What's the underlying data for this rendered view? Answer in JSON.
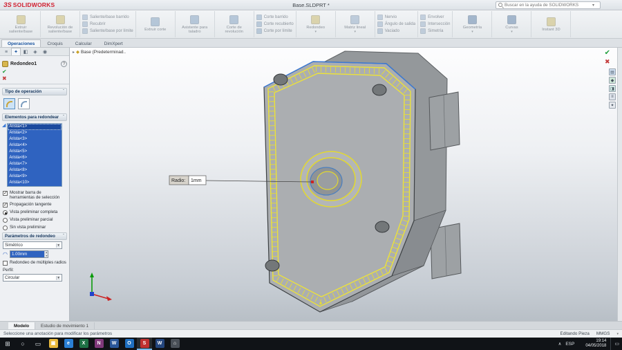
{
  "colors": {
    "selection_blue": "#2f63c0",
    "highlight_yellow": "#e8de30",
    "edge_blue": "#3b7ad6",
    "accept_green": "#1f9e3c",
    "cancel_red": "#c43b3b"
  },
  "title_bar": {
    "logo_glyph": "ЗS",
    "logo_text": "SOLIDWORKS",
    "quick_tools": [
      {
        "name": "new-document-icon",
        "glyph": "▢"
      },
      {
        "name": "open-document-icon",
        "glyph": "◫"
      },
      {
        "name": "save-icon",
        "glyph": "▦"
      },
      {
        "name": "print-icon",
        "glyph": "▤"
      },
      {
        "name": "undo-icon",
        "glyph": "↶"
      },
      {
        "name": "redo-icon",
        "glyph": "↷"
      },
      {
        "name": "options-caret-icon",
        "glyph": "▾"
      }
    ],
    "document_title": "Base.SLDPRT *",
    "search_placeholder": "Buscar en la ayuda de SOLIDWORKS",
    "search_caret": "▾",
    "window_controls": [
      {
        "name": "help-button",
        "glyph": "?"
      },
      {
        "name": "minimize-button",
        "glyph": "–"
      },
      {
        "name": "maximize-button",
        "glyph": "▢"
      },
      {
        "name": "close-button",
        "glyph": "✕"
      }
    ]
  },
  "ribbon": {
    "groups": [
      {
        "kind": "big",
        "name": "ribbon-extrude-boss",
        "label": "Extruir saliente/base",
        "color": "#c9b86a"
      },
      {
        "kind": "big",
        "name": "ribbon-revolve-boss",
        "label": "Revolución de saliente/base",
        "color": "#c9b86a"
      },
      {
        "kind": "stack",
        "name": "ribbon-boss-stack",
        "labels": [
          "Saliente/base barrido",
          "Recubrir",
          "Saliente/base por límite"
        ],
        "color": "#8fa8c4"
      },
      {
        "kind": "big",
        "name": "ribbon-extrude-cut",
        "label": "Extruir corte",
        "color": "#7f9fc0"
      },
      {
        "kind": "big",
        "name": "ribbon-hole-wizard",
        "label": "Asistente para taladro",
        "color": "#7f9fc0"
      },
      {
        "kind": "big",
        "name": "ribbon-revolve-cut",
        "label": "Corte de revolución",
        "color": "#7f9fc0"
      },
      {
        "kind": "stack",
        "name": "ribbon-cut-stack",
        "labels": [
          "Corte barrido",
          "Corte recubierto",
          "Corte por límite"
        ],
        "color": "#7f9fc0"
      },
      {
        "kind": "big",
        "name": "ribbon-fillet",
        "label": "Redondeo",
        "arrow": true,
        "color": "#c9b86a"
      },
      {
        "kind": "big",
        "name": "ribbon-linear-pattern",
        "label": "Matriz lineal",
        "arrow": true,
        "color": "#8fa8c4"
      },
      {
        "kind": "stack",
        "name": "ribbon-feature-stack-1",
        "labels": [
          "Nervio",
          "Ángulo de salida",
          "Vaciado"
        ],
        "color": "#8fa8c4"
      },
      {
        "kind": "stack",
        "name": "ribbon-feature-stack-2",
        "labels": [
          "Envolver",
          "Intersección",
          "Simetría"
        ],
        "color": "#8fa8c4"
      },
      {
        "kind": "big",
        "name": "ribbon-reference-geometry",
        "label": "Geometría",
        "arrow": true,
        "color": "#5a7da6"
      },
      {
        "kind": "big",
        "name": "ribbon-curves",
        "label": "Curvas",
        "arrow": true,
        "color": "#5a7da6"
      },
      {
        "kind": "big",
        "name": "ribbon-instant3d",
        "label": "Instant 3D",
        "color": "#c9b86a"
      }
    ]
  },
  "command_tabs": {
    "items": [
      {
        "label": "Operaciones",
        "active": true,
        "name": "tab-operaciones"
      },
      {
        "label": "Croquis",
        "name": "tab-croquis"
      },
      {
        "label": "Calcular",
        "name": "tab-calcular"
      },
      {
        "label": "DimXpert",
        "name": "tab-dimxpert"
      }
    ]
  },
  "headsup_toolbar": {
    "icons": [
      {
        "name": "zoom-fit-icon",
        "glyph": "◎"
      },
      {
        "name": "zoom-area-icon",
        "glyph": "⊞"
      },
      {
        "name": "previous-view-icon",
        "glyph": "↶"
      },
      {
        "name": "section-view-icon",
        "glyph": "◪"
      },
      {
        "name": "view-orientation-icon",
        "glyph": "⌂▾"
      },
      {
        "name": "display-style-icon",
        "glyph": "◫▾"
      },
      {
        "name": "hide-show-items-icon",
        "glyph": "◉▾"
      },
      {
        "name": "edit-appearance-icon",
        "glyph": "◕"
      },
      {
        "name": "apply-scene-icon",
        "glyph": "▣▾"
      },
      {
        "name": "view-settings-icon",
        "glyph": "▤▾"
      }
    ]
  },
  "property_manager": {
    "tabs": [
      {
        "name": "featuremanager-tab",
        "glyph": "≡"
      },
      {
        "name": "propertymanager-tab",
        "glyph": "✦",
        "active": true
      },
      {
        "name": "configurationmanager-tab",
        "glyph": "◧"
      },
      {
        "name": "dimxpertmanager-tab",
        "glyph": "◈"
      },
      {
        "name": "displaymanager-tab",
        "glyph": "◉"
      }
    ],
    "tabs_overflow": "»",
    "title": "Redondeo1",
    "help_glyph": "?",
    "accept_glyph": "✔",
    "cancel_glyph": "✖",
    "sections": {
      "tipo": {
        "title": "Tipo de operación"
      },
      "elementos": {
        "title": "Elementos para redondear",
        "items": [
          {
            "label": "Arista<1>",
            "active": true
          },
          {
            "label": "Arista<2>"
          },
          {
            "label": "Arista<3>"
          },
          {
            "label": "Arista<4>"
          },
          {
            "label": "Arista<5>"
          },
          {
            "label": "Arista<6>"
          },
          {
            "label": "Arista<7>"
          },
          {
            "label": "Arista<8>"
          },
          {
            "label": "Arista<9>"
          },
          {
            "label": "Arista<10>"
          }
        ]
      },
      "options": {
        "checkbox_selection_toolbar": "Mostrar barra de herramientas de selección",
        "checkbox_tangent": "Propagación tangente",
        "radio_full_preview": "Vista preliminar completa",
        "radio_partial_preview": "Vista preliminar parcial",
        "radio_no_preview": "Sin vista preliminar"
      },
      "parametros": {
        "title": "Parámetros de redondeo",
        "symmetry_value": "Simétrico",
        "radius_value": "1.00mm",
        "multi_radius_label": "Redondeo de múltiples radios",
        "profile_label": "Perfil:",
        "profile_value": "Circular"
      }
    }
  },
  "viewport": {
    "breadcrumb": {
      "arrow": "▸",
      "icon_glyph": "◆",
      "label": "Base (Predeterminad.."
    },
    "callout": {
      "label": "Radio:",
      "value": "1mm"
    },
    "confirm": {
      "accept_glyph": "✔",
      "cancel_glyph": "✖"
    },
    "side_tabs": [
      {
        "name": "taskpane-resources-tab",
        "glyph": "▤",
        "color": "#cfe0f2"
      },
      {
        "name": "taskpane-design-library-tab",
        "glyph": "◆",
        "color": "#cfe8d8"
      },
      {
        "name": "taskpane-file-explorer-tab",
        "glyph": "◨",
        "color": "#cfe8e4"
      },
      {
        "name": "taskpane-appearances-tab",
        "glyph": "≡",
        "color": "#dde2ea"
      },
      {
        "name": "taskpane-custom-properties-tab",
        "glyph": "✦",
        "color": "#e6e9ee"
      }
    ]
  },
  "bottom_tabs": {
    "nav": [
      "◀",
      "▶"
    ],
    "items": [
      {
        "label": "Modelo",
        "active": true,
        "name": "model-tab"
      },
      {
        "label": "Estudio de movimiento 1",
        "name": "motion-study-tab"
      }
    ]
  },
  "status_bar": {
    "message": "Seleccione una anotación para modificar los parámetros",
    "mode": "Editando Pieza",
    "units": "MMGS",
    "units_caret": "▾"
  },
  "taskbar": {
    "start_glyph": "⊞",
    "search_glyph": "○",
    "taskview_glyph": "▭",
    "apps": [
      {
        "name": "file-explorer-app",
        "glyph": "▣",
        "color": "#e8b93c"
      },
      {
        "name": "browser-app",
        "glyph": "e",
        "color": "#2a7fd4"
      },
      {
        "name": "excel-app",
        "glyph": "X",
        "color": "#1e7145"
      },
      {
        "name": "onenote-app",
        "glyph": "N",
        "color": "#80397b"
      },
      {
        "name": "word-app",
        "glyph": "W",
        "color": "#2b579a"
      },
      {
        "name": "outlook-app",
        "glyph": "O",
        "color": "#1f6fc0"
      },
      {
        "name": "solidworks-app",
        "glyph": "S",
        "color": "#c03030",
        "active": true
      },
      {
        "name": "word-document-app",
        "glyph": "W",
        "color": "#24467e"
      },
      {
        "name": "notes-app",
        "glyph": "⌂",
        "color": "#4a5058"
      }
    ],
    "tray": {
      "chevron": "∧",
      "lang": "ESP",
      "icons": [
        {
          "name": "volume-icon",
          "glyph": "◁)"
        },
        {
          "name": "network-icon",
          "glyph": "▟"
        }
      ],
      "time": "19:14",
      "date": "04/05/2018",
      "notification": "▭"
    }
  }
}
